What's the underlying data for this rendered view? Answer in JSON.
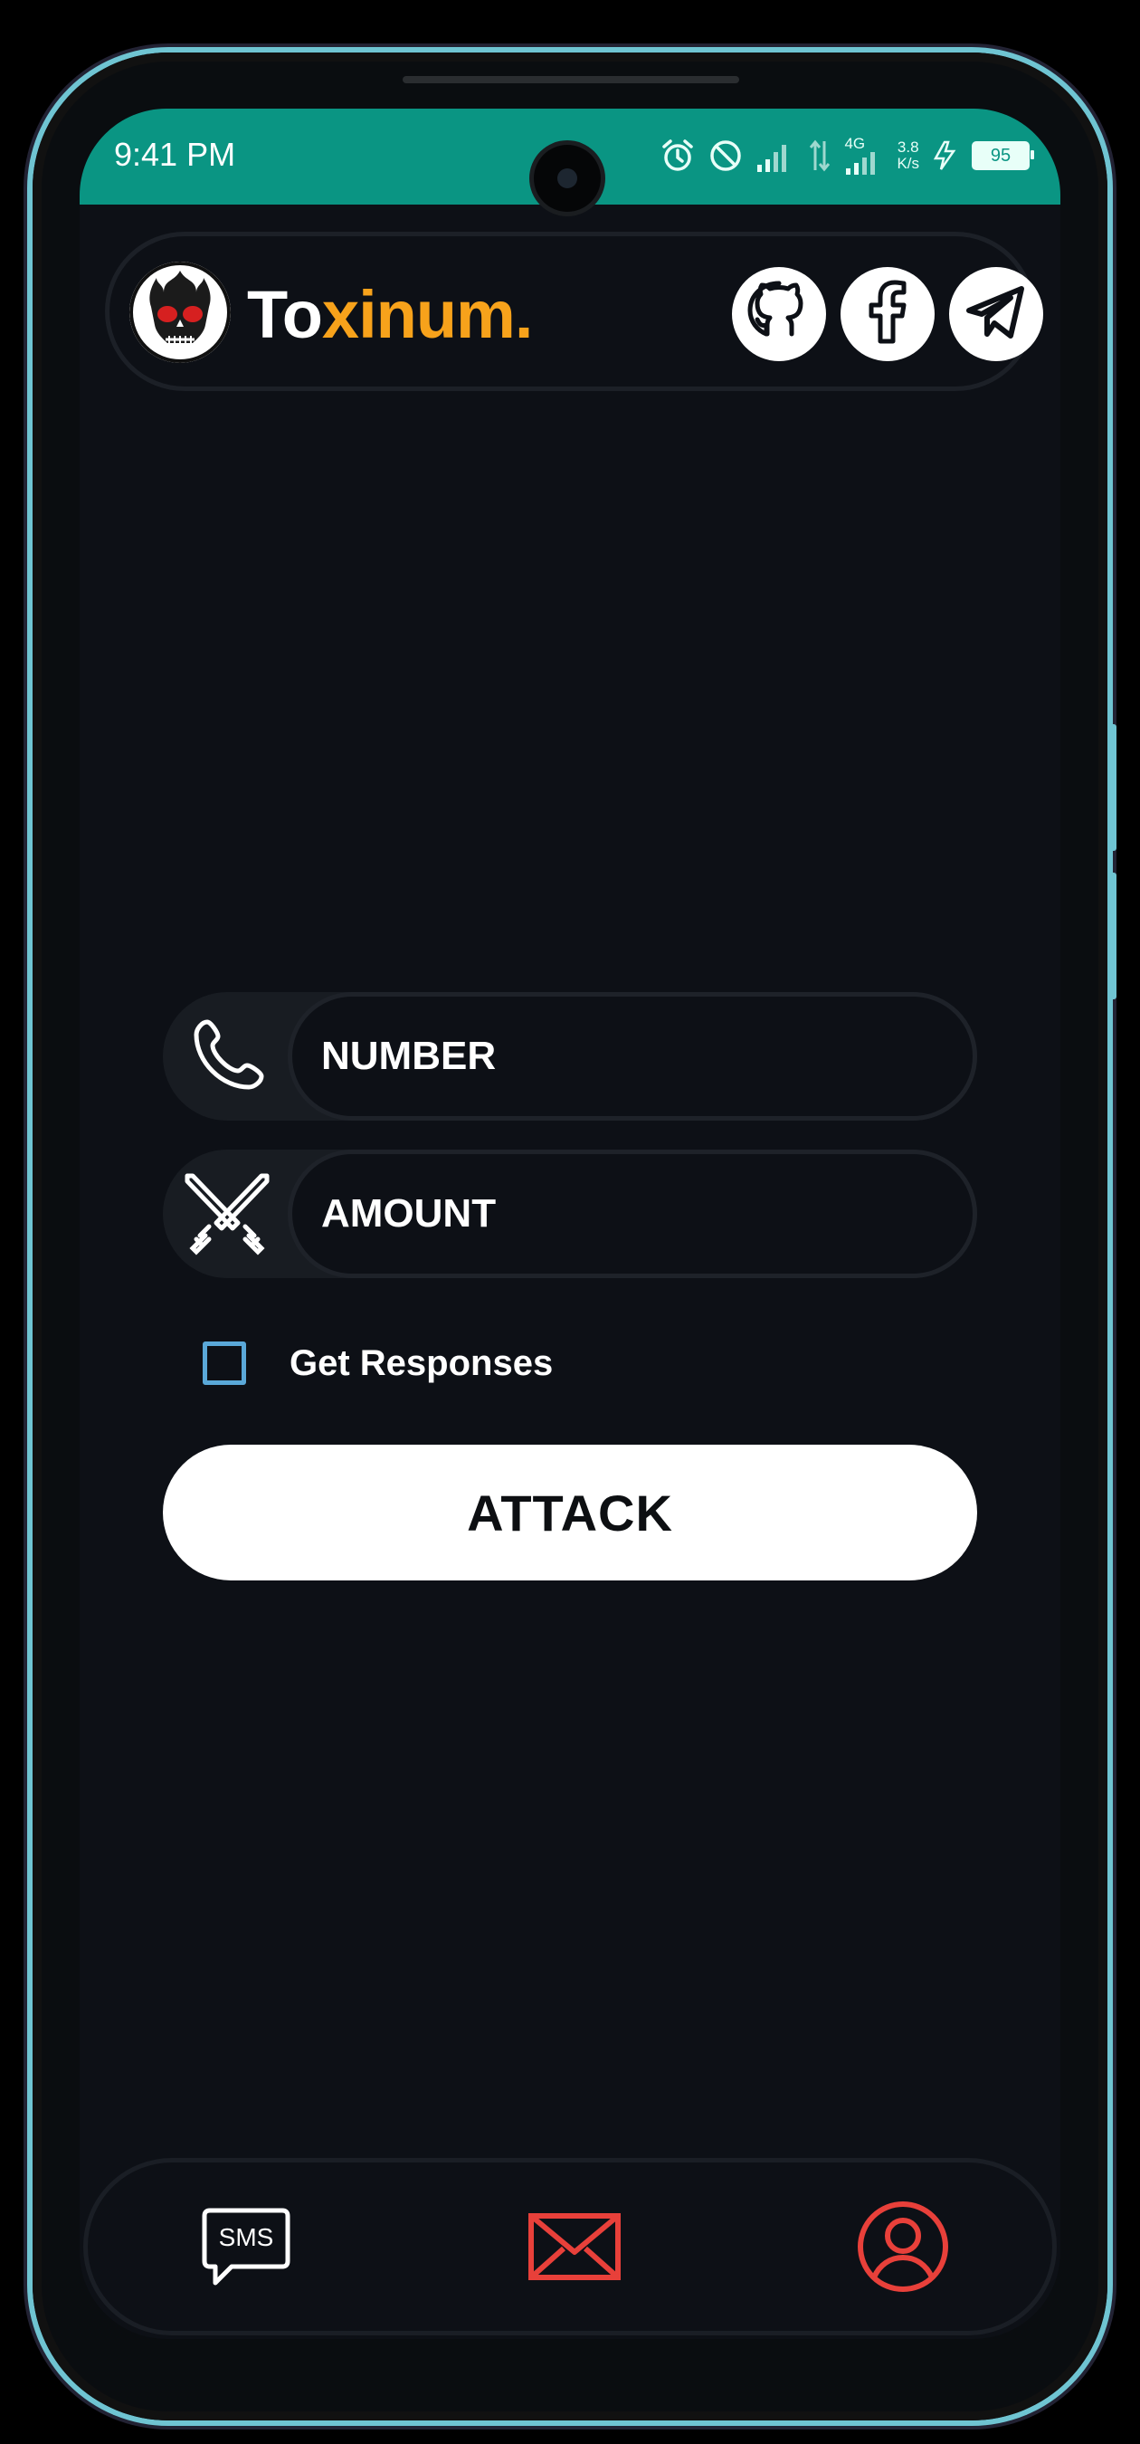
{
  "status_bar": {
    "time": "9:41 PM",
    "network_type": "4G",
    "speed_value": "3.8",
    "speed_unit": "K/s",
    "battery": "95",
    "bg_color": "#0a9583"
  },
  "header": {
    "brand_part1": "To",
    "brand_part2": "xinum.",
    "accent_color": "#f7a21b",
    "social": [
      {
        "icon": "github-icon"
      },
      {
        "icon": "facebook-icon"
      },
      {
        "icon": "telegram-icon"
      }
    ]
  },
  "form": {
    "number_placeholder": "NUMBER",
    "amount_placeholder": "AMOUNT",
    "checkbox_label": "Get Responses",
    "checkbox_checked": false,
    "attack_label": "ATTACK"
  },
  "bottom_nav": {
    "sms_label": "SMS",
    "items": [
      {
        "icon": "sms-icon",
        "color": "#ffffff"
      },
      {
        "icon": "mail-icon",
        "color": "#e8403a"
      },
      {
        "icon": "profile-icon",
        "color": "#e8403a"
      }
    ]
  }
}
